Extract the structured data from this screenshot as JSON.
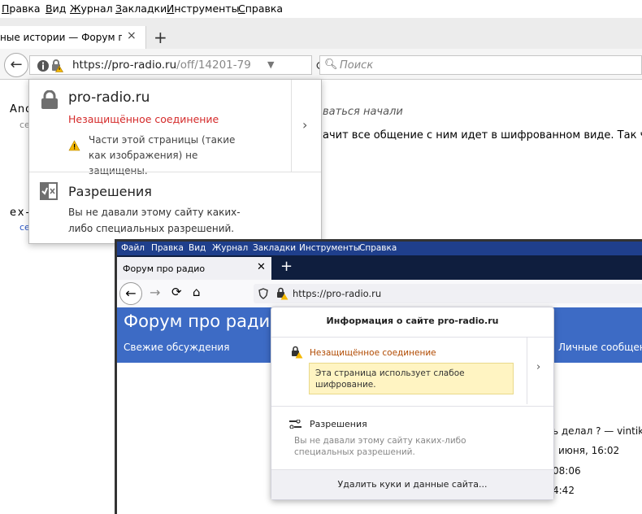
{
  "menubar": {
    "items": [
      "Правка",
      "Вид",
      "Журнал",
      "Закладки",
      "Инструменты",
      "Справка"
    ]
  },
  "tab": {
    "title": "ные истории — Форум п...",
    "close": "×",
    "new_tab": "+"
  },
  "nav": {
    "url_host": "https://pro-radio.ru",
    "url_path": "/off/14201-79",
    "search_placeholder": "Поиск"
  },
  "page": {
    "user1": "Ano",
    "user1_sub": "се",
    "user2": "ex-",
    "user2_sub": "се",
    "italic_line": "ваться начали",
    "line2": "ачит все общение с ним идет в шифрованном виде. Так что"
  },
  "panel1": {
    "site": "pro-radio.ru",
    "insecure": "Незащищённое соединение",
    "warning": "Части этой страницы (такие как изображения) не защищены.",
    "permissions_title": "Разрешения",
    "permissions_text": "Вы не давали этому сайту каких-либо специальных разрешений."
  },
  "inner": {
    "menu": [
      "Файл",
      "Правка",
      "Вид",
      "Журнал",
      "Закладки",
      "Инструменты",
      "Справка"
    ],
    "tab_title": "Форум про радио",
    "url": "https://pro-radio.ru",
    "banner_title": "Форум про радио",
    "banner_link_left": "Свежие обсуждения",
    "banner_link_right": "Личные сообщени",
    "lines": [
      "ь делал ? — vintik,",
      "июня, 16:02",
      "08:06",
      "4:42"
    ]
  },
  "panel2": {
    "header": "Информация о сайте pro-radio.ru",
    "insecure": "Незащищённое соединение",
    "note": "Эта страница использует слабое шифрование.",
    "permissions_title": "Разрешения",
    "permissions_text": "Вы не давали этому сайту каких-либо специальных разрешений.",
    "footer": "Удалить куки и данные сайта..."
  },
  "colors": {
    "insecure_red": "#d42a2a",
    "insecure_orange": "#b14a00",
    "banner_blue": "#3d6bc5",
    "warning_bg": "#fff4c2"
  }
}
